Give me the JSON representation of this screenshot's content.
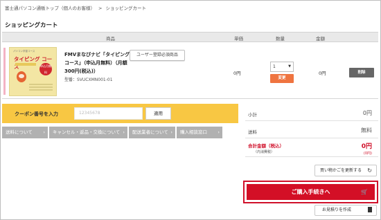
{
  "breadcrumb": [
    "富士通パソコン通販トップ（個人のお客様）",
    "ショッピングカート"
  ],
  "breadcrumb_separator": ">",
  "page_title": "ショッピングカート",
  "table_headers": {
    "product": "商品",
    "unit_price": "単価",
    "quantity": "数量",
    "amount": "金額"
  },
  "item": {
    "thumb_caption": "パソコン学習コース",
    "thumb_title": "タイピング コース",
    "thumb_badge": "申込月無料",
    "name": "FMVまなびナビ「タイピングコース」（申込月無料）（月額300円(税込)）",
    "model": "型番：SVUCXMN001-01",
    "register_button": "ユーザー登録必須商品",
    "unit_price": "0円",
    "quantity": "1",
    "change_button": "変更",
    "amount": "0円",
    "delete_button": "削除"
  },
  "coupon": {
    "label": "クーポン番号を入力",
    "placeholder": "12345678",
    "apply_button": "適用"
  },
  "links": [
    "送料について",
    "キャンセル・返品・交換について",
    "配送業者について",
    "購入相談窓口"
  ],
  "summary": {
    "subtotal_label": "小計",
    "subtotal_value": "0円",
    "shipping_label": "送料",
    "shipping_value": "無料",
    "total_label": "合計金額（税込）",
    "total_note": "（内消費税）",
    "total_value": "0円",
    "tax_value": "(0円)"
  },
  "update_button": "買い物かごを更新する",
  "checkout_button": "ご購入手続きへ",
  "estimate_button": "お見積りを作成",
  "colors": {
    "accent_red": "#d30f26",
    "coupon_yellow": "#f8c743",
    "change_orange": "#ef7440",
    "link_gray": "#b1b1b1"
  },
  "icons": {
    "refresh": "refresh-icon",
    "cart": "cart-icon",
    "document": "document-icon",
    "dropdown": "chevron-down-icon"
  }
}
